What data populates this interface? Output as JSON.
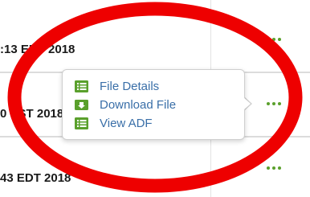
{
  "table": {
    "rows": [
      {
        "date_text": ":13 EDT 2018"
      },
      {
        "date_text": "0 EST 2018"
      },
      {
        "date_text": "43 EDT 2018"
      }
    ]
  },
  "context_menu": {
    "items": [
      {
        "label": "File Details",
        "icon": "list-icon"
      },
      {
        "label": "Download File",
        "icon": "download-icon"
      },
      {
        "label": "View ADF",
        "icon": "list-icon"
      }
    ]
  },
  "colors": {
    "accent_green": "#5aa02c",
    "link_blue": "#3a6fa8",
    "annotation_red": "#ee0000"
  }
}
